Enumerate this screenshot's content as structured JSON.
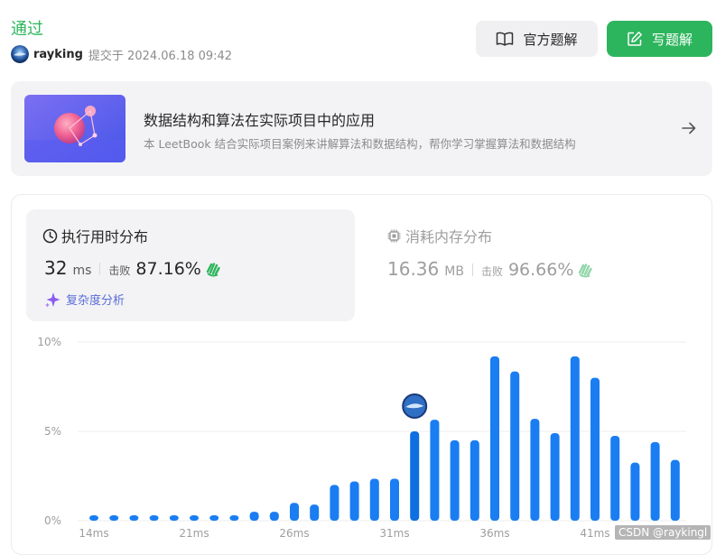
{
  "submission": {
    "status": "通过",
    "username": "rayking",
    "submitted_text": "提交于 2024.06.18 09:42"
  },
  "header_buttons": {
    "official_solution": "官方题解",
    "write_solution": "写题解"
  },
  "banner": {
    "title": "数据结构和算法在实际项目中的应用",
    "subtitle": "本 LeetBook 结合实际项目案例来讲解算法和数据结构，帮你学习掌握算法和数据结构"
  },
  "runtime": {
    "title": "执行用时分布",
    "value": "32",
    "unit": "ms",
    "beats_label": "击败",
    "beats": "87.16%",
    "complexity_link": "复杂度分析"
  },
  "memory": {
    "title": "消耗内存分布",
    "value": "16.36",
    "unit": "MB",
    "beats_label": "击败",
    "beats": "96.66%"
  },
  "colors": {
    "accent_green": "#2db55d",
    "bar_blue": "#1a7df2",
    "bar_blue_current": "#0d6fe0"
  },
  "chart_data": {
    "type": "bar",
    "x": [
      14,
      15,
      16,
      17,
      18,
      19,
      20,
      21,
      22,
      23,
      24,
      25,
      26,
      27,
      28,
      29,
      30,
      31,
      32,
      33,
      34,
      35,
      36,
      37,
      38,
      39,
      40,
      41,
      42,
      43,
      44
    ],
    "values": [
      0.3,
      0.3,
      0.3,
      0.3,
      0.3,
      0.3,
      0.3,
      0.3,
      0.5,
      0.5,
      1.0,
      0.9,
      2.0,
      2.2,
      2.35,
      2.35,
      5.0,
      5.65,
      4.5,
      4.5,
      9.2,
      8.35,
      5.7,
      4.9,
      9.2,
      8.0,
      4.75,
      3.25,
      4.4,
      3.4
    ],
    "x_tick_labels": [
      "14ms",
      "21ms",
      "26ms",
      "31ms",
      "36ms",
      "41ms"
    ],
    "x_tick_values": [
      14,
      19,
      24,
      29,
      34,
      39
    ],
    "y_tick_labels": [
      "0%",
      "5%",
      "10%"
    ],
    "y_tick_values": [
      0,
      5,
      10
    ],
    "ylim": [
      0,
      10
    ],
    "highlight_value": 30,
    "grid": true,
    "xlabel": "",
    "ylabel": ""
  },
  "watermark": "CSDN @raykingl"
}
